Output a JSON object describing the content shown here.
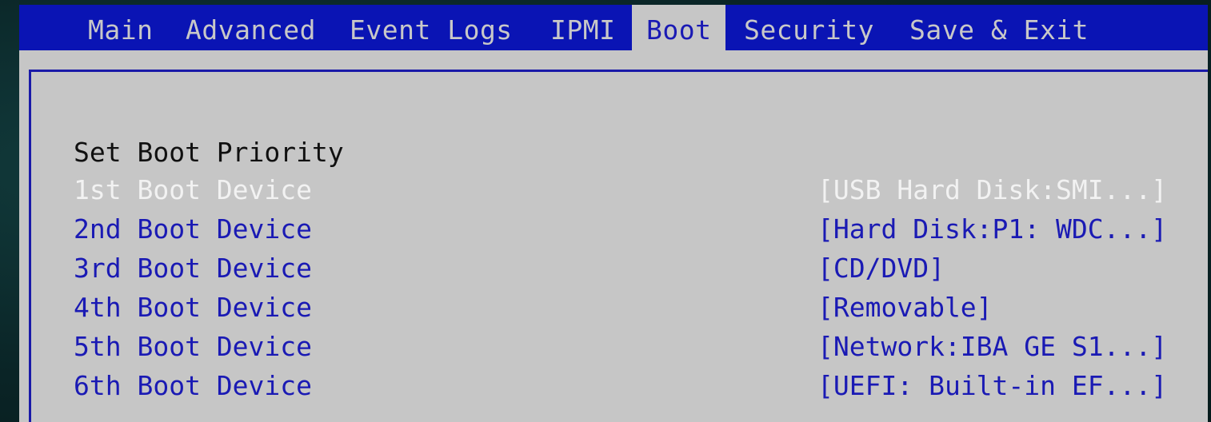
{
  "menu": {
    "tabs": [
      {
        "label": "Main"
      },
      {
        "label": "Advanced"
      },
      {
        "label": "Event Logs"
      },
      {
        "label": "IPMI"
      },
      {
        "label": "Boot"
      },
      {
        "label": "Security"
      },
      {
        "label": "Save & Exit"
      }
    ],
    "active_tab": "Boot"
  },
  "boot": {
    "section_title": "Set Boot Priority",
    "devices": [
      {
        "label": "1st Boot Device",
        "value": "[USB Hard Disk:SMI...]",
        "selected": true
      },
      {
        "label": "2nd Boot Device",
        "value": "[Hard Disk:P1: WDC...]",
        "selected": false
      },
      {
        "label": "3rd Boot Device",
        "value": "[CD/DVD]",
        "selected": false
      },
      {
        "label": "4th Boot Device",
        "value": "[Removable]",
        "selected": false
      },
      {
        "label": "5th Boot Device",
        "value": "[Network:IBA GE S1...]",
        "selected": false
      },
      {
        "label": "6th Boot Device",
        "value": "[UEFI: Built-in EF...]",
        "selected": false
      }
    ]
  },
  "colors": {
    "menubar_bg": "#0a14b4",
    "panel_bg": "#c6c6c6",
    "item_text": "#1a1ab4",
    "selected_text": "#f2f2f2",
    "title_text": "#101010"
  }
}
